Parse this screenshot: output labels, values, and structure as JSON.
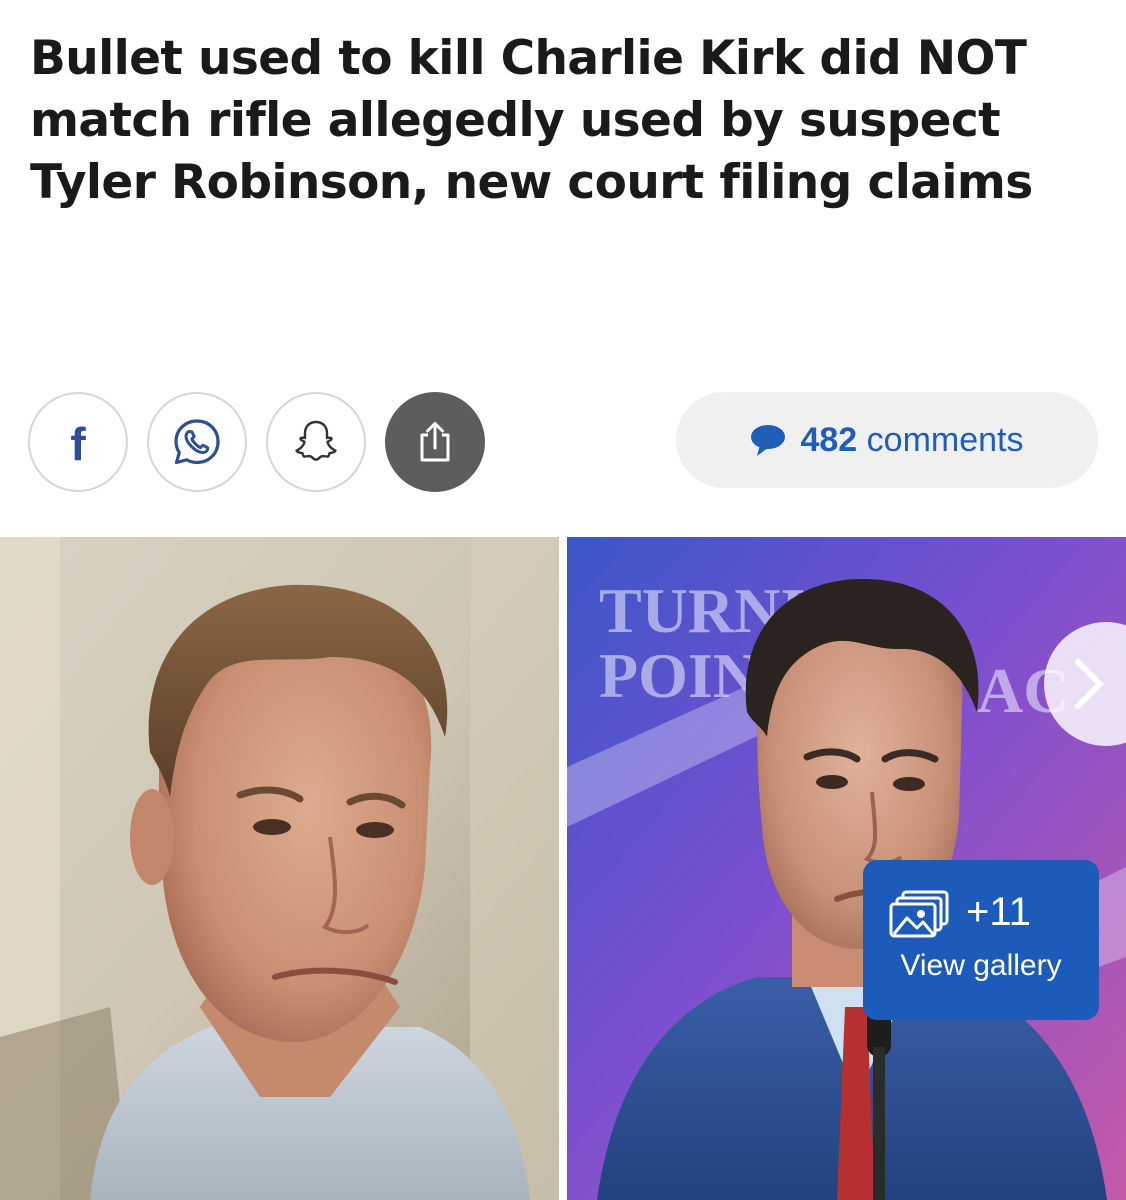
{
  "article": {
    "headline": "Bullet used to kill Charlie Kirk did NOT match rifle allegedly used by suspect Tyler Robinson, new court filing claims"
  },
  "share": {
    "buttons": [
      {
        "name": "facebook",
        "icon": "facebook-icon",
        "glyph": "f"
      },
      {
        "name": "whatsapp",
        "icon": "whatsapp-icon"
      },
      {
        "name": "snapchat",
        "icon": "snapchat-icon"
      },
      {
        "name": "share",
        "icon": "share-icon"
      }
    ]
  },
  "comments": {
    "count": "482",
    "label": "comments",
    "icon": "speech-bubble-icon"
  },
  "gallery": {
    "count": "+11",
    "label": "View gallery",
    "icon": "gallery-icon",
    "next_icon": "chevron-right-icon",
    "backdrop_text": [
      "TURNING",
      "POINT",
      "AC"
    ]
  },
  "colors": {
    "headline": "#1a1a1a",
    "accent": "#1e5db8",
    "badge": "#1c5bb9",
    "share_active": "#5d5d5d",
    "pill": "#f0f0f0"
  }
}
